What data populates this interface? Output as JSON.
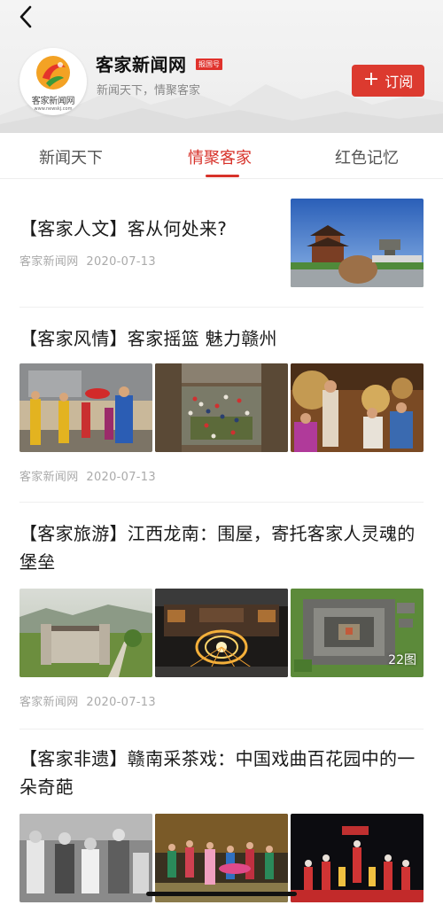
{
  "header": {
    "logo_text": "客家新闻网",
    "logo_url": "www.newskj.com",
    "brand_name": "客家新闻网",
    "badge": "报国号",
    "slogan": "新闻天下，情聚客家",
    "subscribe_label": "订阅",
    "subscribe_icon": "plus-icon",
    "back_icon": "chevron-left-icon",
    "accent_color": "#dc3a2f"
  },
  "tabs": [
    {
      "label": "新闻天下",
      "active": false
    },
    {
      "label": "情聚客家",
      "active": true
    },
    {
      "label": "红色记忆",
      "active": false
    }
  ],
  "articles": [
    {
      "title": "【客家人文】客从何处来?",
      "source": "客家新闻网",
      "date": "2020-07-13"
    },
    {
      "title": "【客家风情】客家摇篮  魅力赣州",
      "source": "客家新闻网",
      "date": "2020-07-13"
    },
    {
      "title": "【客家旅游】江西龙南：围屋，寄托客家人灵魂的堡垒",
      "source": "客家新闻网",
      "date": "2020-07-13",
      "image_count": "22图"
    },
    {
      "title": "【客家非遗】赣南采茶戏：中国戏曲百花园中的一朵奇葩"
    }
  ]
}
